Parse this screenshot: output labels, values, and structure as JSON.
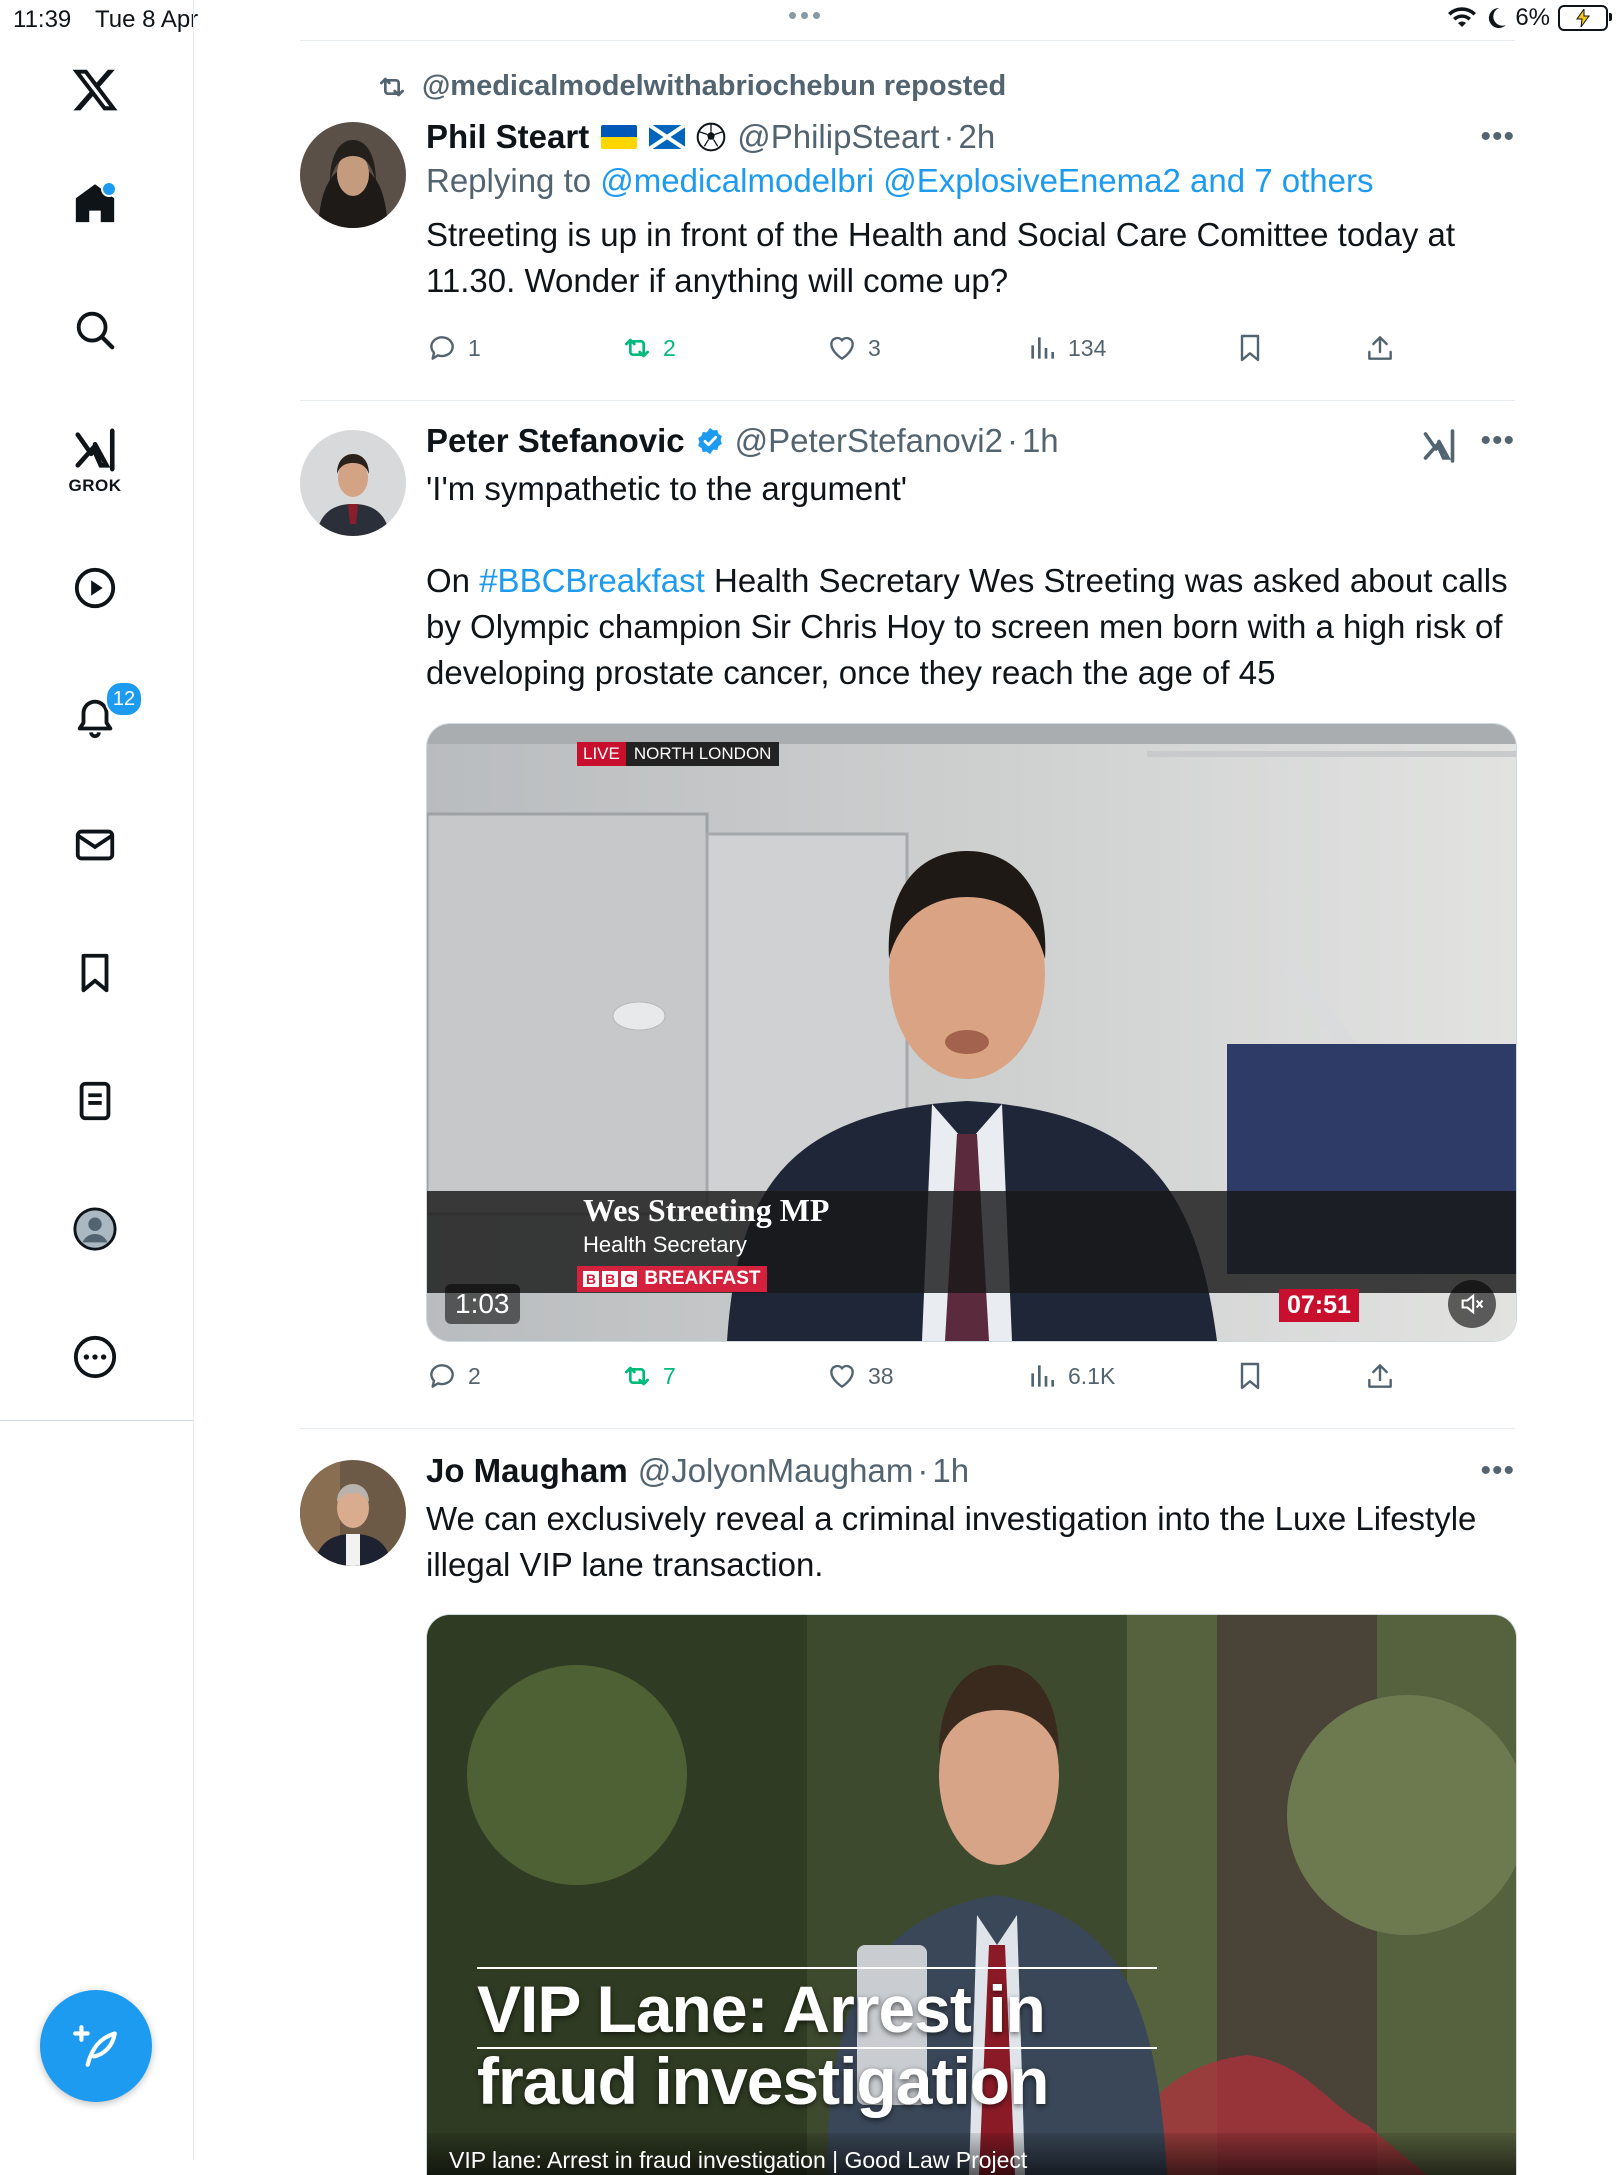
{
  "status_bar": {
    "time": "11:39",
    "date": "Tue 8 Apr",
    "battery": "6%"
  },
  "sidebar": {
    "logo": "x-logo-icon",
    "items": [
      {
        "name": "home",
        "icon": "home-icon"
      },
      {
        "name": "explore",
        "icon": "search-icon"
      },
      {
        "name": "grok",
        "icon": "grok-icon",
        "label": "GROK"
      },
      {
        "name": "video",
        "icon": "play-icon"
      },
      {
        "name": "notifications",
        "icon": "bell-icon",
        "badge": "12"
      },
      {
        "name": "messages",
        "icon": "mail-icon"
      },
      {
        "name": "bookmarks",
        "icon": "bookmark-icon"
      },
      {
        "name": "lists",
        "icon": "list-icon"
      },
      {
        "name": "profile",
        "icon": "profile-icon"
      },
      {
        "name": "more",
        "icon": "more-icon"
      }
    ],
    "compose_icon": "compose-icon"
  },
  "posts": [
    {
      "repost_by": "@medicalmodelwithabriochebun reposted",
      "name": "Phil Steart",
      "handle": "@PhilipSteart",
      "time": "2h",
      "replying_prefix": "Replying to ",
      "replying_to": "@medicalmodelbri @ExplosiveEnema2 and 7 others",
      "text": "Streeting is up in front of the Health and Social Care Comittee today at 11.30. Wonder if anything will come up?",
      "replies": "1",
      "reposts": "2",
      "likes": "3",
      "views": "134"
    },
    {
      "name": "Peter Stefanovic",
      "handle": "@PeterStefanovi2",
      "time": "1h",
      "text_line1": "'I'm sympathetic to the argument'",
      "text_prefix": "On ",
      "hashtag": "#BBCBreakfast",
      "text_rest": " Health Secretary Wes Streeting was asked about calls by Olympic champion Sir Chris Hoy to screen men born with a high risk of developing prostate cancer, once they reach the age of 45",
      "video": {
        "live_tag": "LIVE",
        "location": "NORTH LONDON",
        "lower_third_name": "Wes Streeting MP",
        "lower_third_title": "Health Secretary",
        "program": "BREAKFAST",
        "bbc": [
          "B",
          "B",
          "C"
        ],
        "clock": "07:51",
        "duration": "1:03"
      },
      "replies": "2",
      "reposts": "7",
      "likes": "38",
      "views": "6.1K"
    },
    {
      "name": "Jo Maugham",
      "handle": "@JolyonMaugham",
      "time": "1h",
      "text": "We can exclusively reveal a criminal investigation into the Luxe Lifestyle illegal VIP lane transaction.",
      "card": {
        "headline_line1": "VIP Lane: Arrest in",
        "headline_line2": "fraud investigation",
        "caption": "VIP lane: Arrest in fraud investigation | Good Law Project"
      }
    }
  ],
  "colors": {
    "accent": "#1d9bf0",
    "repost_green": "#00ba7c",
    "secondary_text": "#536471"
  }
}
